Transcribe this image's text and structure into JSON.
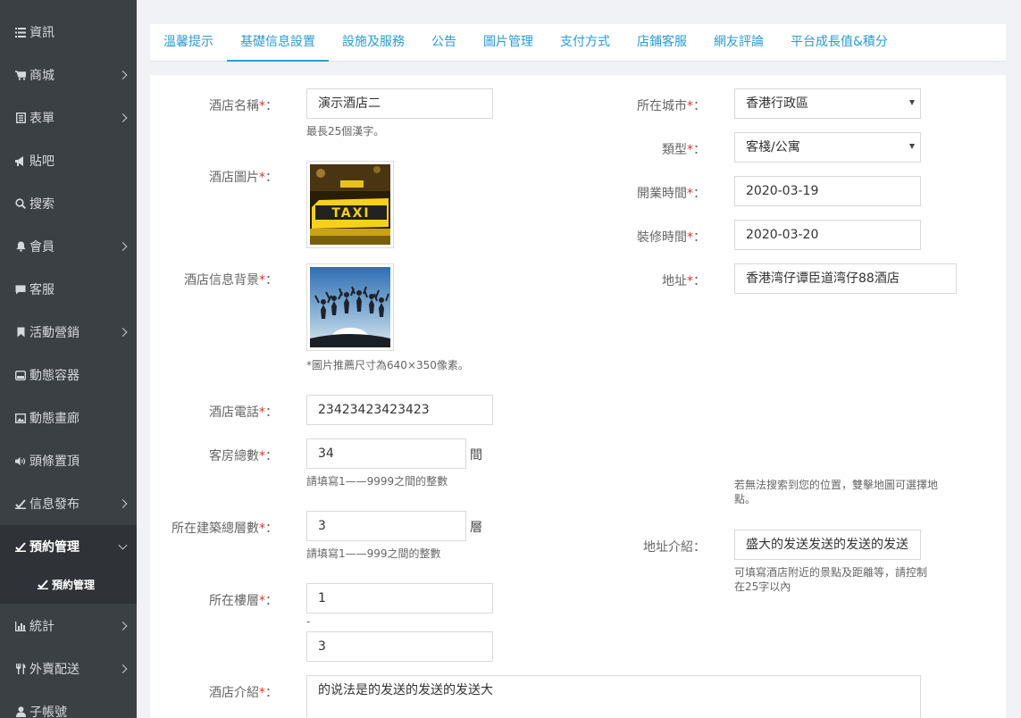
{
  "sidebar": {
    "items": [
      {
        "label": "資訊",
        "icon": "list-icon"
      },
      {
        "label": "商城",
        "icon": "cart-icon"
      },
      {
        "label": "表單",
        "icon": "form-icon"
      },
      {
        "label": "貼吧",
        "icon": "megaphone-icon"
      },
      {
        "label": "搜索",
        "icon": "search-icon"
      },
      {
        "label": "會員",
        "icon": "bell-icon"
      },
      {
        "label": "客服",
        "icon": "chat-icon"
      },
      {
        "label": "活動營銷",
        "icon": "bookmark-icon"
      },
      {
        "label": "動態容器",
        "icon": "hdd-icon"
      },
      {
        "label": "動態畫廊",
        "icon": "picture-icon"
      },
      {
        "label": "頭條置頂",
        "icon": "volume-icon"
      },
      {
        "label": "信息發布",
        "icon": "check-icon"
      },
      {
        "label": "預約管理",
        "icon": "check-icon"
      },
      {
        "label": "統計",
        "icon": "bar-chart-icon"
      },
      {
        "label": "外賣配送",
        "icon": "cutlery-icon"
      },
      {
        "label": "子帳號",
        "icon": "user-icon"
      }
    ],
    "sub_item": "預約管理"
  },
  "tabs": [
    "溫馨提示",
    "基礎信息設置",
    "設施及服務",
    "公告",
    "圖片管理",
    "支付方式",
    "店鋪客服",
    "網友評論",
    "平台成長值&積分"
  ],
  "form": {
    "required_mark": "*",
    "colon": "：",
    "hotel_name": {
      "label": "酒店名稱",
      "value": "演示酒店二",
      "hint": "最長25個漢字。"
    },
    "hotel_image": {
      "label": "酒店圖片"
    },
    "hotel_bg": {
      "label": "酒店信息背景",
      "hint": "*圖片推薦尺寸為640×350像素。"
    },
    "phone": {
      "label": "酒店電話",
      "value": "23423423423423"
    },
    "rooms": {
      "label": "客房總數",
      "value": "34",
      "unit": "間",
      "hint": "請填寫1——9999之間的整數"
    },
    "floors": {
      "label": "所在建築總層數",
      "value": "3",
      "unit": "層",
      "hint": "請填寫1——999之間的整數"
    },
    "floor": {
      "label": "所在樓層",
      "from": "1",
      "sep": "-",
      "to": "3"
    },
    "intro": {
      "label": "酒店介紹",
      "value": "的说法是的发送的发送的发送大"
    },
    "city": {
      "label": "所在城市",
      "value": "香港行政區"
    },
    "type": {
      "label": "類型",
      "value": "客棧/公寓"
    },
    "open_date": {
      "label": "開業時間",
      "value": "2020-03-19"
    },
    "renovate_date": {
      "label": "裝修時間",
      "value": "2020-03-20"
    },
    "address": {
      "label": "地址",
      "value": "香港湾仔谭臣道湾仔88酒店",
      "hint": "若無法搜索到您的位置，雙擊地圖可選擇地點。"
    },
    "address_intro": {
      "label": "地址介紹",
      "value": "盛大的发送发送的发送的发送",
      "hint": "可填寫酒店附近的景點及距離等，請控制在25字以內"
    }
  },
  "colors": {
    "sidebar_bg": "#3b4045",
    "sidebar_active": "#2f3337",
    "accent": "#2b9bd3",
    "required": "#e5322d"
  }
}
